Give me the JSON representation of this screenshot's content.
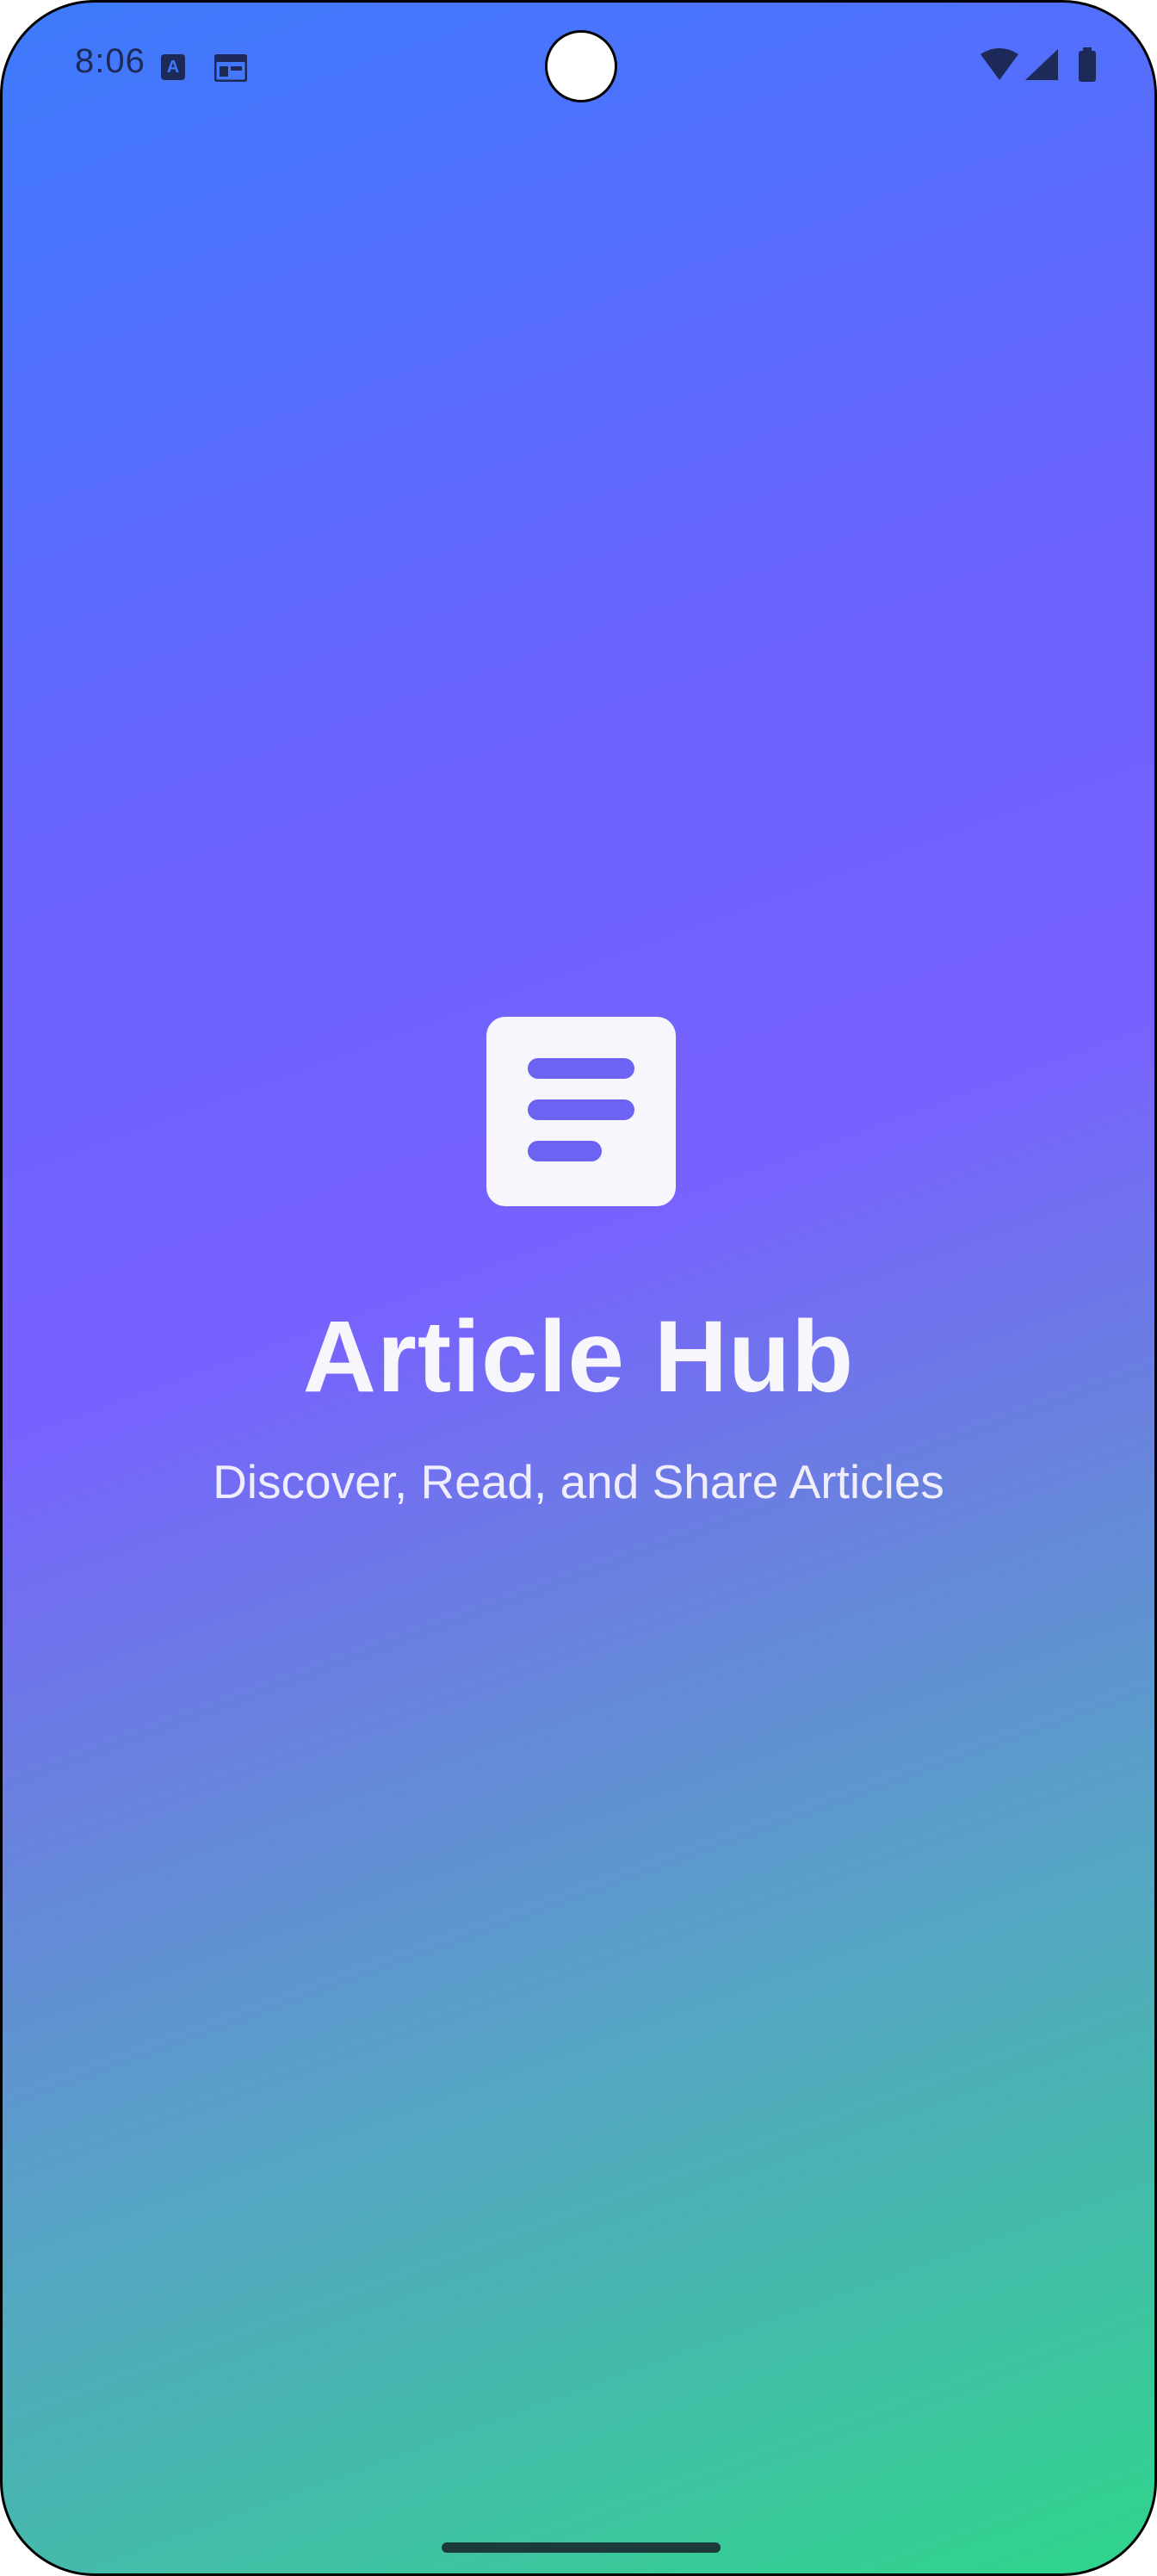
{
  "status_bar": {
    "time": "8:06",
    "left_icons": [
      "a-badge-icon",
      "calendar-icon"
    ],
    "right_icons": [
      "wifi-icon",
      "signal-icon",
      "battery-icon"
    ]
  },
  "splash": {
    "title": "Article Hub",
    "subtitle": "Discover, Read, and Share Articles",
    "logo_icon": "article-icon"
  },
  "colors": {
    "gradient_top": "#3d7bfb",
    "gradient_middle": "#7862ff",
    "gradient_bottom": "#2fd58b",
    "logo_background": "#f7f6fd",
    "logo_lines": "#6c63f3",
    "status_icons": "#1d2a57"
  }
}
